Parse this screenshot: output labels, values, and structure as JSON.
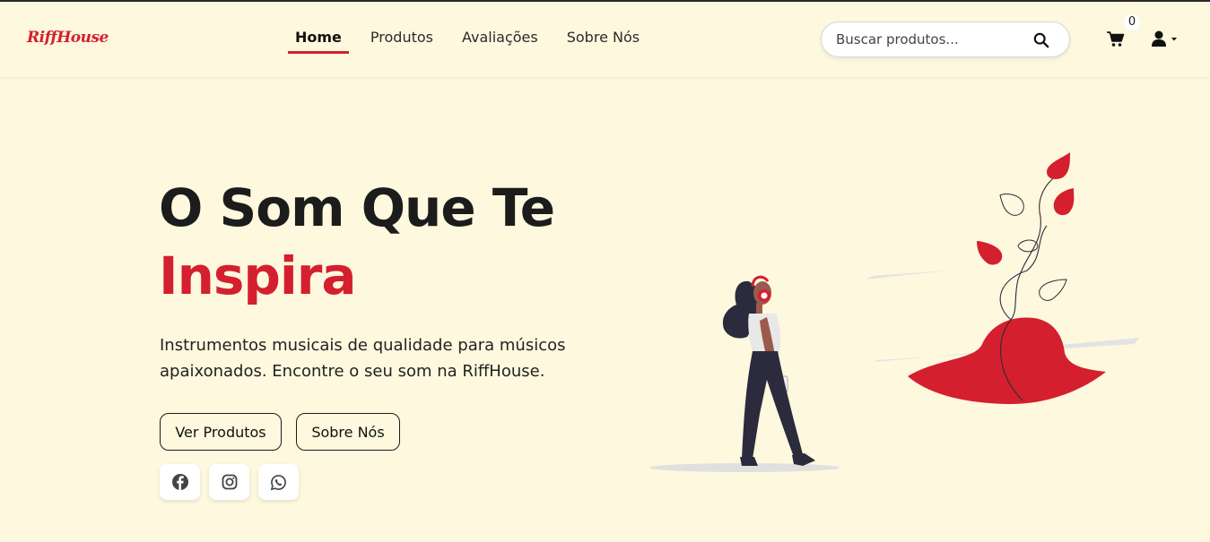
{
  "header": {
    "logo": "RiffHouse",
    "nav": [
      {
        "label": "Home",
        "active": true
      },
      {
        "label": "Produtos",
        "active": false
      },
      {
        "label": "Avaliações",
        "active": false
      },
      {
        "label": "Sobre Nós",
        "active": false
      }
    ],
    "search": {
      "placeholder": "Buscar produtos...",
      "icon": "search-icon"
    },
    "cart": {
      "icon": "cart-icon",
      "count": "0"
    },
    "user": {
      "icon": "user-icon",
      "dropdown_icon": "caret-down-icon"
    }
  },
  "hero": {
    "title_line1": "O Som Que Te",
    "title_line2": "Inspira",
    "subtitle": "Instrumentos musicais de qualidade para músicos apaixonados. Encontre o seu som na RiffHouse.",
    "buttons": [
      {
        "label": "Ver Produtos"
      },
      {
        "label": "Sobre Nós"
      }
    ],
    "social": [
      {
        "icon": "facebook-icon"
      },
      {
        "icon": "instagram-icon"
      },
      {
        "icon": "whatsapp-icon"
      }
    ]
  },
  "colors": {
    "accent": "#d41f2f",
    "background": "#fdf8de",
    "text": "#1c1c1c"
  }
}
